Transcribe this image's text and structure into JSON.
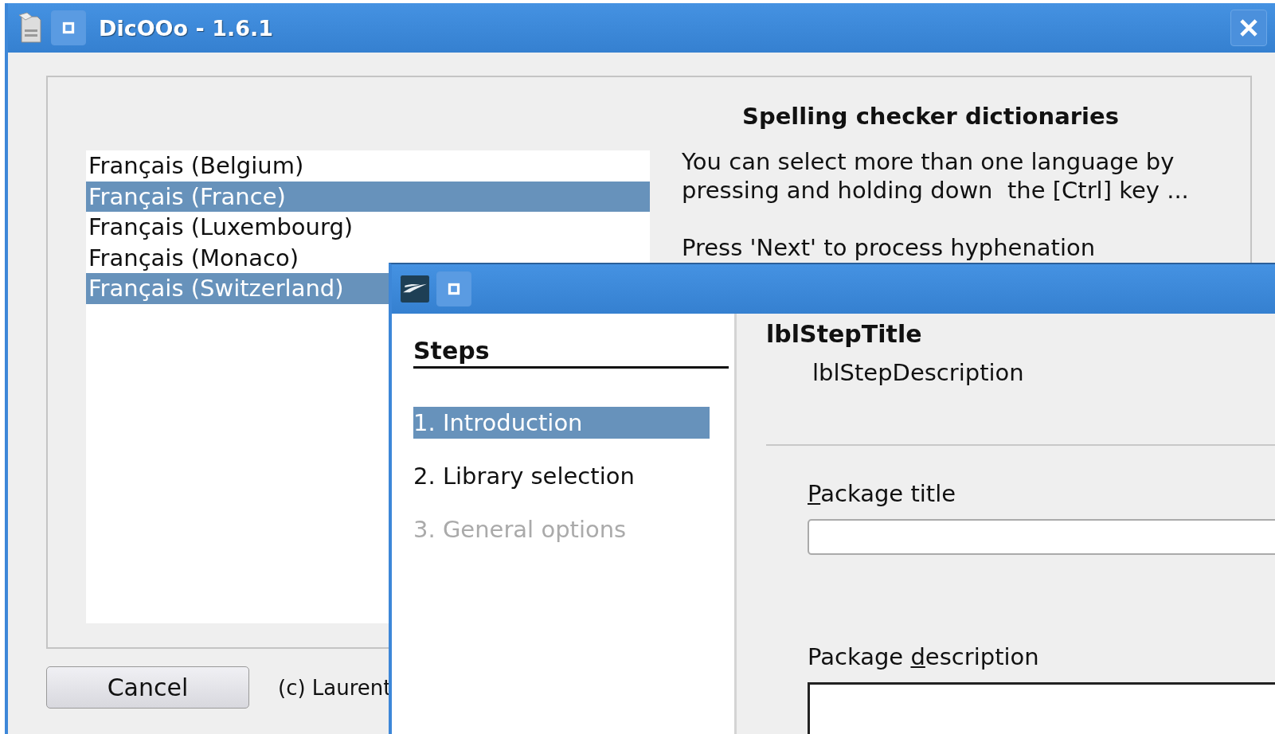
{
  "main_window": {
    "title": "DicOOo - 1.6.1",
    "languages": [
      {
        "label": "Français (Belgium)",
        "selected": false
      },
      {
        "label": "Français (France)",
        "selected": true
      },
      {
        "label": "Français (Luxembourg)",
        "selected": false
      },
      {
        "label": "Français (Monaco)",
        "selected": false
      },
      {
        "label": "Français (Switzerland)",
        "selected": true
      }
    ],
    "heading": "Spelling checker dictionaries",
    "description_lines": [
      "You can select more than one language by",
      "pressing and holding down  the [Ctrl] key ..."
    ],
    "hint": "Press 'Next' to process hyphenation",
    "cancel_button": "Cancel",
    "copyright": "(c) Laurent"
  },
  "wizard_window": {
    "steps_heading": "Steps",
    "steps": [
      {
        "label": "1. Introduction",
        "selected": true,
        "disabled": false
      },
      {
        "label": "2. Library selection",
        "selected": false,
        "disabled": false
      },
      {
        "label": "3. General options",
        "selected": false,
        "disabled": true
      }
    ],
    "step_title": "lblStepTitle",
    "step_description": "lblStepDescription",
    "fields": [
      {
        "kind": "line",
        "label": {
          "key": "P",
          "after": "ackage title"
        }
      },
      {
        "kind": "area",
        "label": {
          "before": "Package ",
          "key": "d",
          "after": "escription"
        }
      }
    ]
  }
}
